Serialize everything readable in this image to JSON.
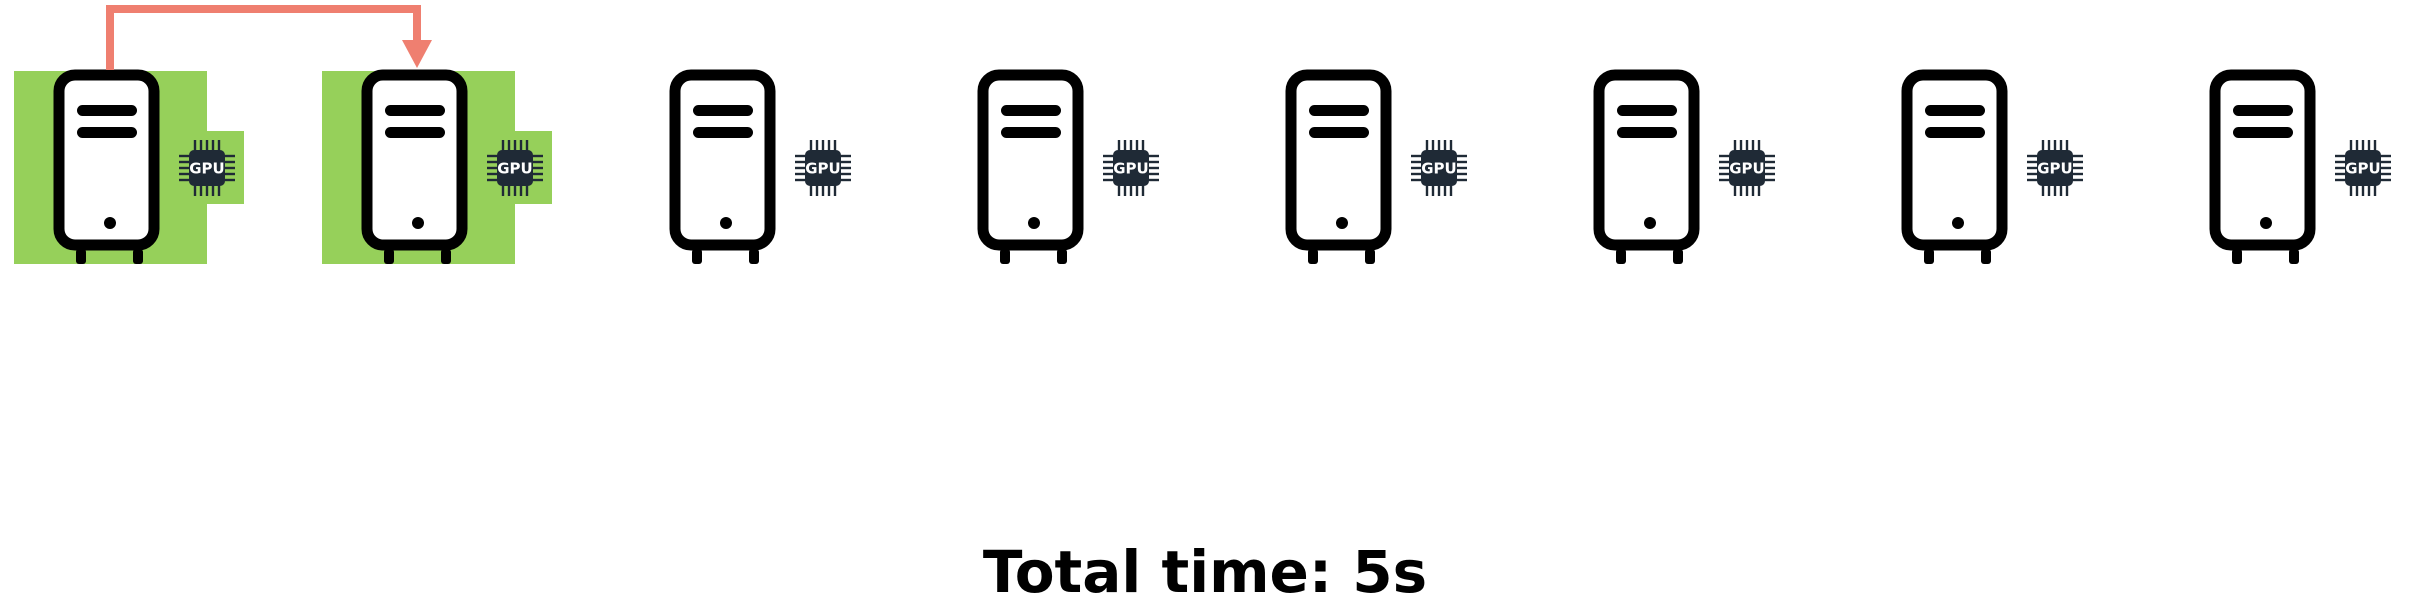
{
  "diagram": {
    "gpu_label": "GPU",
    "total_time_text": "Total time: 5s",
    "server_count": 8,
    "active_servers": [
      1,
      2
    ],
    "transfer": {
      "from": 1,
      "to": 2
    },
    "icons": {
      "server": "server-tower-icon",
      "gpu": "gpu-chip-icon",
      "arrow": "transfer-arrow-icon"
    },
    "colors": {
      "active_highlight": "#96d05a",
      "arrow": "#ef7f70",
      "icon": "#000000",
      "chip": "#1f2a36",
      "background": "#ffffff"
    }
  }
}
